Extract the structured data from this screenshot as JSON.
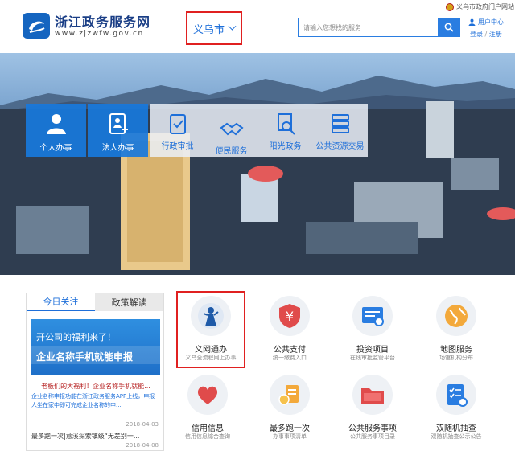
{
  "header": {
    "site_title": "浙江政务服务网",
    "site_url": "www.zjzwfw.gov.cn",
    "city": "义乌市",
    "search_placeholder": "请输入您想找的服务",
    "portal_link": "义乌市政府门户网站",
    "user_center": "用户中心",
    "login": "登录",
    "register": "注册"
  },
  "banner": {
    "tiles": [
      {
        "label": "个人办事",
        "icon": "person-icon"
      },
      {
        "label": "法人办事",
        "icon": "id-card-icon"
      },
      {
        "label": "行政审批",
        "icon": "clipboard-check-icon"
      },
      {
        "label": "便民服务",
        "icon": "handshake-icon"
      },
      {
        "label": "阳光政务",
        "icon": "magnifier-doc-icon"
      },
      {
        "label": "公共资源交易",
        "icon": "database-icon"
      }
    ]
  },
  "news": {
    "tabs": [
      "今日关注",
      "政策解读"
    ],
    "image_line1": "开公司的福利来了！",
    "image_line2": "企业名称手机就能申报",
    "headline": "老板们的大福利！企业名称手机就能...",
    "desc": "企业名称申报功能在浙江政务服务APP上线，申报人坐在家中即可完成企业名称的申...",
    "date1": "2018-04-03",
    "item2": "最多跑一次|意溪探索镇级“无差别一...",
    "date2": "2018-04-08"
  },
  "services": [
    {
      "title": "义网通办",
      "sub": "义乌全流程网上办事",
      "icon": "yiwu-figure-icon"
    },
    {
      "title": "公共支付",
      "sub": "统一缴费入口",
      "icon": "yen-shield-icon"
    },
    {
      "title": "投资项目",
      "sub": "在线审批监管平台",
      "icon": "project-monitor-icon"
    },
    {
      "title": "地图服务",
      "sub": "场馆机构分布",
      "icon": "globe-icon"
    },
    {
      "title": "信用信息",
      "sub": "信用信息综合查询",
      "icon": "heart-icon"
    },
    {
      "title": "最多跑一次",
      "sub": "办事事项清单",
      "icon": "coins-list-icon"
    },
    {
      "title": "公共服务事项",
      "sub": "公共服务事项目录",
      "icon": "folder-icon"
    },
    {
      "title": "双随机抽查",
      "sub": "双随机抽查公示公告",
      "icon": "checklist-icon"
    }
  ]
}
